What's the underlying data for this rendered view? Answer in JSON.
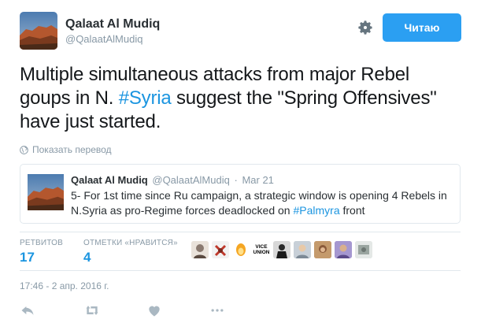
{
  "author": {
    "name": "Qalaat Al Mudiq",
    "handle": "@QalaatAlMudiq"
  },
  "header": {
    "follow_label": "Читаю",
    "follow_color": "#2b9ff2",
    "settings_icon": "gear-icon"
  },
  "tweet": {
    "text_parts": [
      "Multiple simultaneous attacks from major Rebel goups in N. ",
      "#Syria",
      " suggest the \"Spring Offensives\" have just started."
    ],
    "translate_label": "Показать перевод",
    "timestamp": "17:46 - 2 апр. 2016 г."
  },
  "quote": {
    "name": "Qalaat Al Mudiq",
    "handle": "@QalaatAlMudiq",
    "separator": "·",
    "date": "Mar 21",
    "text_parts": [
      "5- For 1st time since Ru campaign, a strategic window is opening 4 Rebels in N.Syria as pro-Regime forces deadlocked on ",
      "#Palmyra",
      " front"
    ]
  },
  "stats": {
    "retweets_label": "РЕТВИТОВ",
    "retweets_value": "17",
    "likes_label": "ОТМЕТКИ «НРАВИТСЯ»",
    "likes_value": "4"
  },
  "likers": [
    {
      "name": "liker-avatar-1",
      "color": "#8a7a70"
    },
    {
      "name": "liker-avatar-2",
      "color": "#c0392b"
    },
    {
      "name": "liker-avatar-3",
      "color": "#f5a623"
    },
    {
      "name": "liker-avatar-vice",
      "text_line1": "VICE",
      "text_line2": "UNION"
    },
    {
      "name": "liker-avatar-5",
      "color": "#3a3a3a"
    },
    {
      "name": "liker-avatar-6",
      "color": "#7d8a96"
    },
    {
      "name": "liker-avatar-7",
      "color": "#8a5a3a"
    },
    {
      "name": "liker-avatar-8",
      "color": "#5b4a8a"
    },
    {
      "name": "liker-avatar-9",
      "color": "#9aa5a0"
    }
  ],
  "actions": [
    "reply-icon",
    "retweet-icon",
    "like-icon",
    "more-icon"
  ],
  "colors": {
    "accent": "#1b95e0",
    "muted": "#8899a6",
    "border": "#e1e8ed"
  }
}
